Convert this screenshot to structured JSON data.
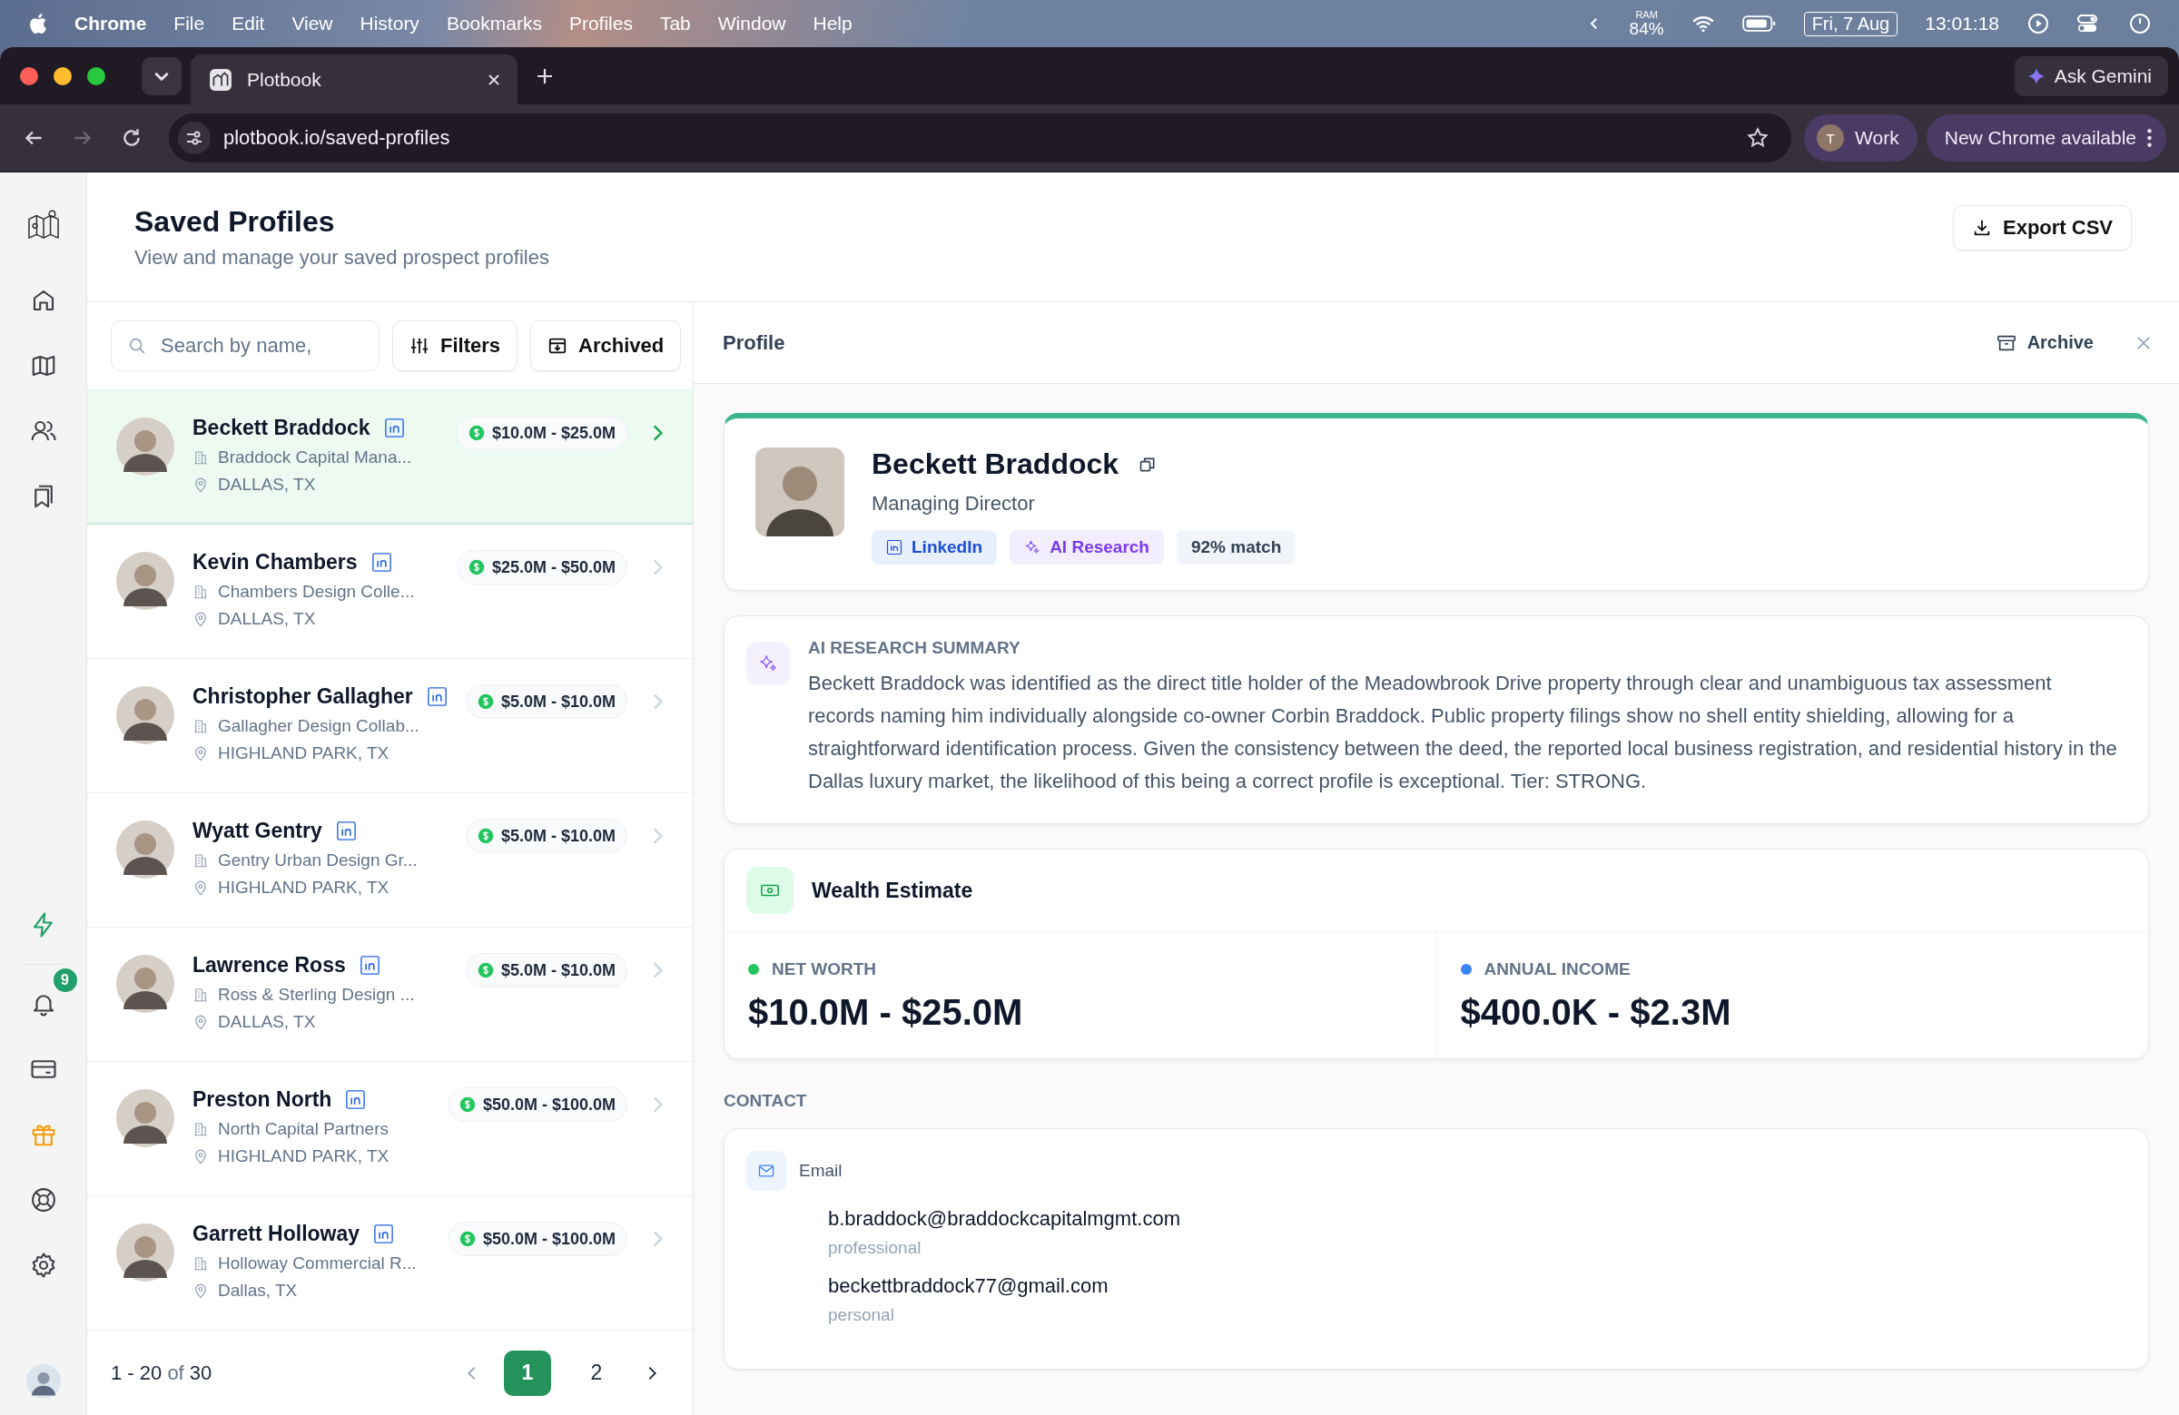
{
  "menu_bar": {
    "app": "Chrome",
    "items": [
      "File",
      "Edit",
      "View",
      "History",
      "Bookmarks",
      "Profiles",
      "Tab",
      "Window",
      "Help"
    ],
    "ram_label": "RAM",
    "ram": "84%",
    "date": "Fri, 7 Aug",
    "time": "13:01:18"
  },
  "browser": {
    "tabs": [
      {
        "title": "Plotbook",
        "selected": true
      }
    ],
    "ask": "Ask Gemini",
    "url": "plotbook.io/saved-profiles",
    "profile_initial": "T",
    "profile_name": "Work",
    "update": "New Chrome available"
  },
  "sidebar": {
    "notification_count": "9"
  },
  "page": {
    "title": "Saved Profiles",
    "subtitle": "View and manage your saved prospect profiles",
    "export": "Export CSV"
  },
  "list": {
    "search_placeholder": "Search by name,",
    "filters": "Filters",
    "archived": "Archived",
    "profiles": [
      {
        "name": "Beckett Braddock",
        "company": "Braddock Capital Mana...",
        "location": "DALLAS, TX",
        "net_worth": "$10.0M - $25.0M",
        "selected": true
      },
      {
        "name": "Kevin Chambers",
        "company": "Chambers Design Colle...",
        "location": "DALLAS, TX",
        "net_worth": "$25.0M - $50.0M",
        "selected": false
      },
      {
        "name": "Christopher Gallagher",
        "company": "Gallagher Design Collab...",
        "location": "HIGHLAND PARK, TX",
        "net_worth": "$5.0M - $10.0M",
        "selected": false
      },
      {
        "name": "Wyatt Gentry",
        "company": "Gentry Urban Design Gr...",
        "location": "HIGHLAND PARK, TX",
        "net_worth": "$5.0M - $10.0M",
        "selected": false
      },
      {
        "name": "Lawrence Ross",
        "company": "Ross & Sterling Design ...",
        "location": "DALLAS, TX",
        "net_worth": "$5.0M - $10.0M",
        "selected": false
      },
      {
        "name": "Preston North",
        "company": "North Capital Partners",
        "location": "HIGHLAND PARK, TX",
        "net_worth": "$50.0M - $100.0M",
        "selected": false
      },
      {
        "name": "Garrett Holloway",
        "company": "Holloway Commercial R...",
        "location": "Dallas, TX",
        "net_worth": "$50.0M - $100.0M",
        "selected": false
      }
    ],
    "range": "**1 - 20** of **30**",
    "pages": [
      {
        "label": "1",
        "selected": true
      },
      {
        "label": "2",
        "selected": false
      }
    ]
  },
  "detail": {
    "header": "Profile",
    "archive": "Archive",
    "name": "Beckett Braddock",
    "role": "Managing Director",
    "tags": [
      {
        "kind": "linkedin",
        "label": "LinkedIn"
      },
      {
        "kind": "ai",
        "label": "AI Research"
      },
      {
        "kind": "match",
        "label": "92% match"
      }
    ],
    "summary_title": "AI RESEARCH SUMMARY",
    "summary": "Beckett Braddock was identified as the direct title holder of the Meadowbrook Drive property through clear and unambiguous tax assessment records naming him individually alongside co-owner Corbin Braddock. Public property filings show no shell entity shielding, allowing for a straightforward identification process. Given the consistency between the deed, the reported local business registration, and residential history in the Dallas luxury market, the likelihood of this being a correct profile is exceptional. Tier: STRONG.",
    "wealth_title": "Wealth Estimate",
    "metrics": [
      {
        "label": "NET WORTH",
        "value": "$10.0M - $25.0M",
        "color": "#22c55e"
      },
      {
        "label": "ANNUAL INCOME",
        "value": "$400.0K - $2.3M",
        "color": "#3b82f6"
      }
    ],
    "contact_title": "CONTACT",
    "email_label": "Email",
    "emails": [
      {
        "address": "b.braddock@braddockcapitalmgmt.com",
        "type": "professional"
      },
      {
        "address": "beckettbraddock77@gmail.com",
        "type": "personal"
      }
    ]
  }
}
